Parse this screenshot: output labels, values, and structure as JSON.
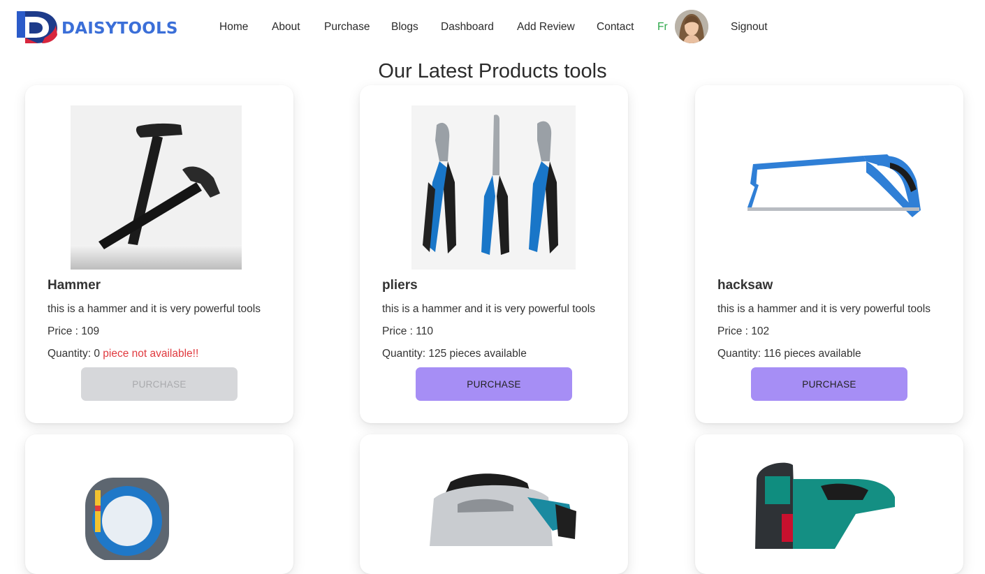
{
  "brand": {
    "name": "DAISYTOOLS",
    "color": "#3b6fd8"
  },
  "nav": {
    "links": [
      "Home",
      "About",
      "Purchase",
      "Blogs",
      "Dashboard",
      "Add Review",
      "Contact"
    ],
    "language": "Fr",
    "signout": "Signout"
  },
  "page_title": "Our Latest Products tools",
  "products": [
    {
      "name": "Hammer",
      "description": "this is a hammer and it is very powerful tools",
      "price": "Price : 109",
      "quantity": "Quantity: 0",
      "availability": "piece not available!!",
      "button": "PURCHASE",
      "available": false
    },
    {
      "name": "pliers",
      "description": "this is a hammer and it is very powerful tools",
      "price": "Price : 110",
      "quantity": "Quantity: 125",
      "availability": "pieces available",
      "button": "PURCHASE",
      "available": true
    },
    {
      "name": "hacksaw",
      "description": "this is a hammer and it is very powerful tools",
      "price": "Price : 102",
      "quantity": "Quantity: 116",
      "availability": "pieces available",
      "button": "PURCHASE",
      "available": true
    }
  ],
  "colors": {
    "accent": "#a68ef5",
    "warning": "#e0393e",
    "lang": "#2ea84a",
    "disabled": "#d6d7da"
  }
}
